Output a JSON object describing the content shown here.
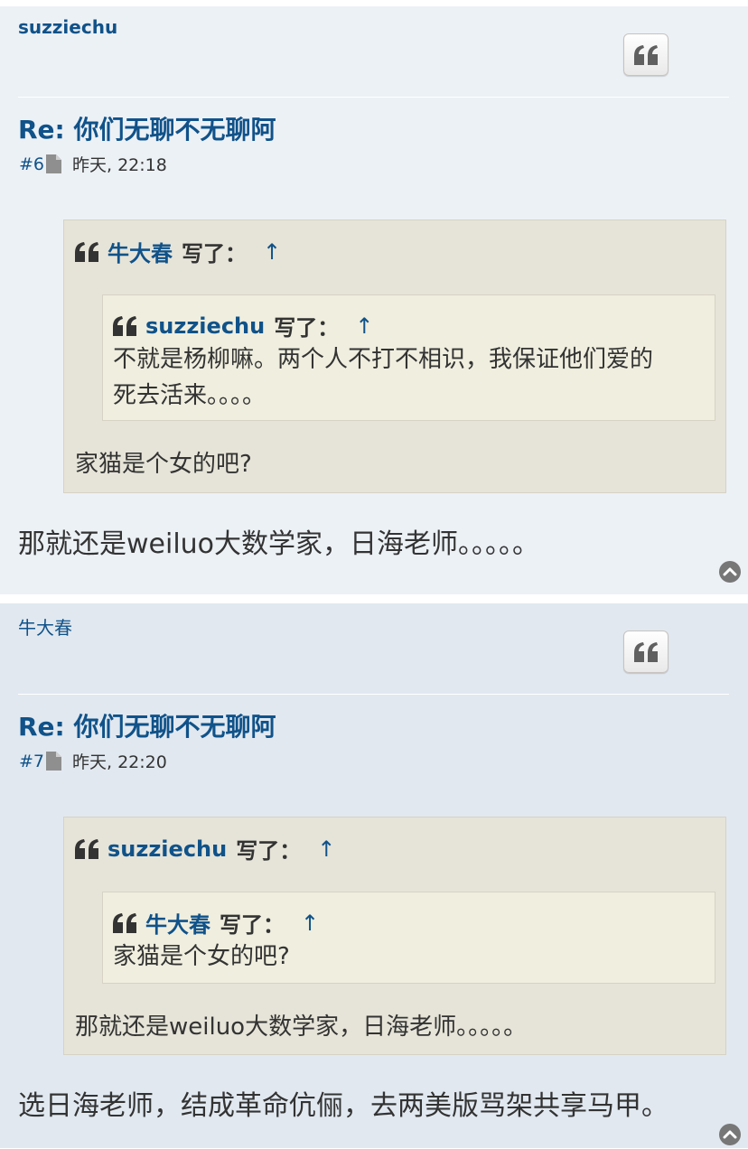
{
  "posts": [
    {
      "author": "suzziechu",
      "title": "Re: 你们无聊不无聊阿",
      "number": "#6",
      "time": "昨天, 22:18",
      "quote": {
        "cite_name": "牛大春",
        "wrote": "写了：",
        "up": "↑",
        "nested": {
          "cite_name": "suzziechu",
          "wrote": "写了：",
          "up": "↑",
          "text_line1": "不就是杨柳嘛。两个人不打不相识，我保证他们爱的",
          "text_line2": "死去活来。。。。"
        },
        "text": "家猫是个女的吧?"
      },
      "body": "那就还是weiluo大数学家，日海老师。。。。。"
    },
    {
      "author": "牛大春",
      "title": "Re: 你们无聊不无聊阿",
      "number": "#7",
      "time": "昨天, 22:20",
      "quote": {
        "cite_name": "suzziechu",
        "wrote": "写了：",
        "up": "↑",
        "nested": {
          "cite_name": "牛大春",
          "wrote": "写了：",
          "up": "↑",
          "text_line1": "家猫是个女的吧?"
        },
        "text": "那就还是weiluo大数学家，日海老师。。。。。"
      },
      "body": "选日海老师，结成革命伉俪，去两美版骂架共享马甲。"
    }
  ],
  "icons": {
    "quote_button": "quote-icon",
    "file": "file-icon",
    "back_to_top": "chevron-up-circle-icon"
  },
  "colors": {
    "link": "#105289",
    "post_bg1": "#ecf1f6",
    "post_bg2": "#e1e8f0",
    "quote_outer_bg": "#e6e4d8",
    "quote_inner_bg": "#efeedf"
  }
}
